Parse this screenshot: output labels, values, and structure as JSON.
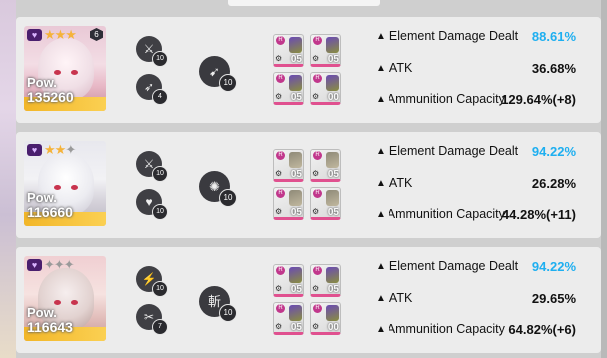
{
  "colors": {
    "highlight": "#1eaff0",
    "burst_badge": "#4a1f6e",
    "power_footer": "#f2b628",
    "gear_trim": "#e0508f"
  },
  "characters": [
    {
      "pow_label": "Pow.",
      "pow_value": "135260",
      "stars_on": "★★★",
      "stars_off": "",
      "core_level": "6",
      "skills": [
        {
          "icon": "crossed-weapons-icon",
          "glyph": "⚔",
          "level": "10"
        },
        {
          "icon": "arrow-skill-icon",
          "glyph": "➶",
          "level": "4"
        }
      ],
      "burst": {
        "icon": "bullet-skill-icon",
        "glyph": "➹",
        "level": "10"
      },
      "gear": [
        "05",
        "05",
        "05",
        "00"
      ],
      "stats": [
        {
          "name": "Element Damage Dealt",
          "value": "88.61%",
          "highlight": true
        },
        {
          "name": "ATK",
          "value": "36.68%",
          "highlight": false
        },
        {
          "name": "Ammunition Capacity",
          "value": "129.64%(+8)",
          "highlight": false
        }
      ]
    },
    {
      "pow_label": "Pow.",
      "pow_value": "116660",
      "stars_on": "★★",
      "stars_off": "✦",
      "core_level": "",
      "skills": [
        {
          "icon": "crossed-weapons-icon",
          "glyph": "⚔",
          "level": "10"
        },
        {
          "icon": "heart-skill-icon",
          "glyph": "♥",
          "level": "10"
        }
      ],
      "burst": {
        "icon": "flame-skill-icon",
        "glyph": "✺",
        "level": "10"
      },
      "gear": [
        "05",
        "05",
        "05",
        "05"
      ],
      "stats": [
        {
          "name": "Element Damage Dealt",
          "value": "94.22%",
          "highlight": true
        },
        {
          "name": "ATK",
          "value": "26.28%",
          "highlight": false
        },
        {
          "name": "Ammunition Capacity",
          "value": "44.28%(+11)",
          "highlight": false
        }
      ]
    },
    {
      "pow_label": "Pow.",
      "pow_value": "116643",
      "stars_on": "",
      "stars_off": "✦✦✦",
      "core_level": "",
      "skills": [
        {
          "icon": "slash-skill-icon",
          "glyph": "⚡",
          "level": "10"
        },
        {
          "icon": "blade-skill-icon",
          "glyph": "✂",
          "level": "7"
        }
      ],
      "burst": {
        "icon": "kanji-skill-icon",
        "glyph": "斬",
        "level": "10"
      },
      "gear": [
        "05",
        "05",
        "05",
        "00"
      ],
      "stats": [
        {
          "name": "Element Damage Dealt",
          "value": "94.22%",
          "highlight": true
        },
        {
          "name": "ATK",
          "value": "29.65%",
          "highlight": false
        },
        {
          "name": "Ammunition Capacity",
          "value": "64.82%(+6)",
          "highlight": false
        }
      ]
    }
  ],
  "ui": {
    "stat_arrow": "▲",
    "burst_glyph": "♥",
    "gear_mark": "R"
  }
}
